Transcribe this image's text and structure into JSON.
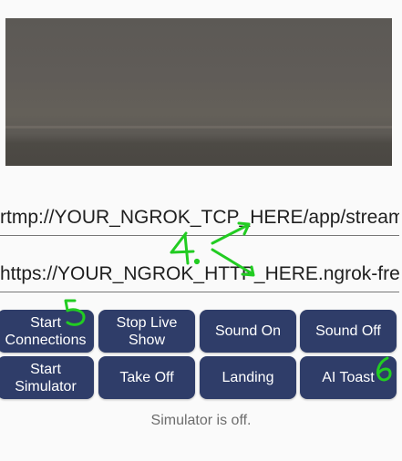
{
  "camera_preview": {},
  "fields": {
    "rtmp_url": "rtmp://YOUR_NGROK_TCP_HERE/app/stream",
    "http_url": "https://YOUR_NGROK_HTTP_HERE.ngrok-free."
  },
  "buttons": {
    "start_connections": "Start\nConnections",
    "stop_live_show": "Stop Live\nShow",
    "sound_on": "Sound On",
    "sound_off": "Sound Off",
    "start_simulator": "Start\nSimulator",
    "take_off": "Take Off",
    "landing": "Landing",
    "ai_toast": "AI Toast"
  },
  "status_text": "Simulator is off.",
  "annotations": {
    "label_4": "4.",
    "label_5": "5",
    "label_6": "6",
    "color": "#22cc22"
  },
  "colors": {
    "button_bg": "#2f3d69",
    "button_text": "#ffffff",
    "status_text": "#6d6d6d"
  }
}
